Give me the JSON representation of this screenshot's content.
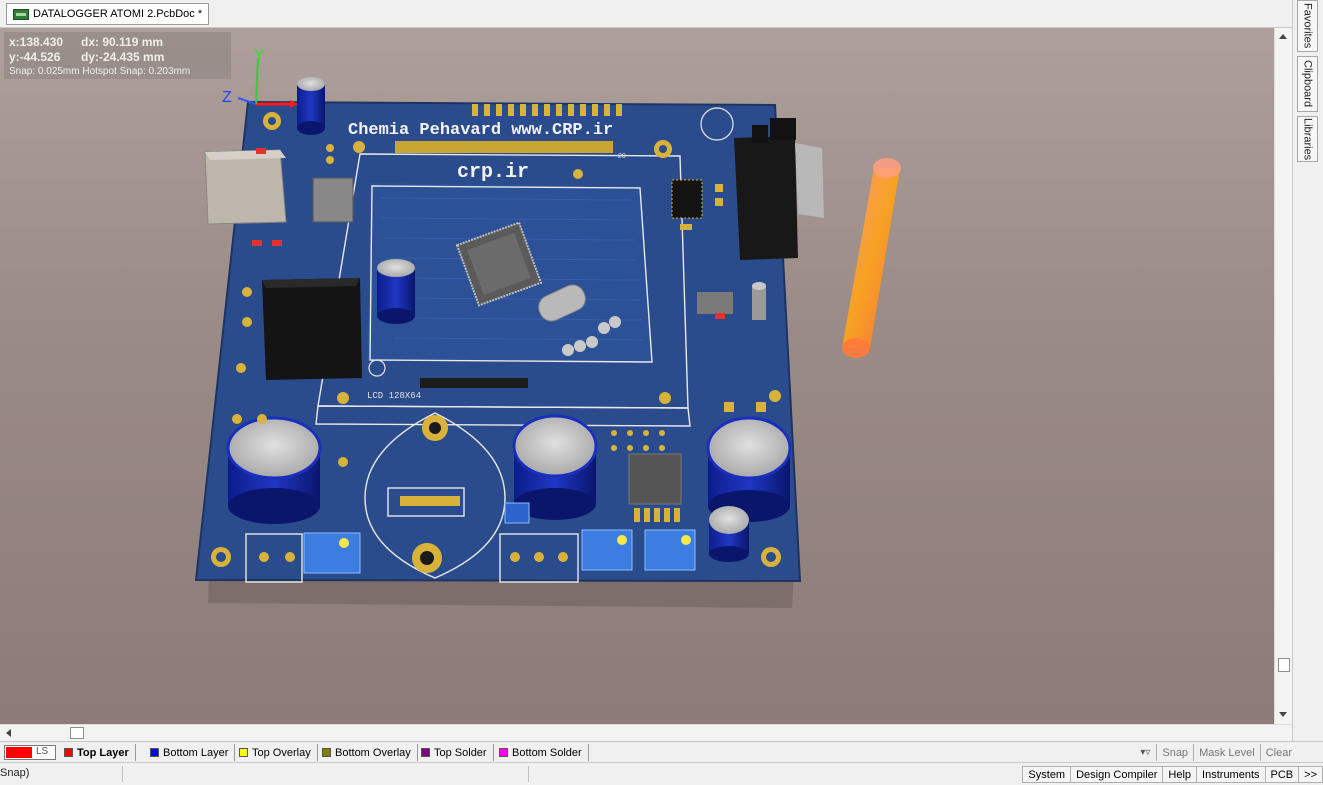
{
  "document_tab": {
    "title": "DATALOGGER ATOMI 2.PcbDoc *"
  },
  "side_panel": {
    "tabs": [
      "Favorites",
      "Clipboard",
      "Libraries"
    ]
  },
  "coords": {
    "x": "x:138.430",
    "dx": "dx: 90.119 mm",
    "y": "y:-44.526",
    "dy": "dy:-24.435  mm",
    "snap": "Snap: 0.025mm Hotspot Snap: 0.203mm"
  },
  "axes": {
    "x": "X",
    "y": "Y",
    "z": "Z"
  },
  "board": {
    "title": "Chemia Pehavard www.CRP.ir",
    "logo": "crp.ir",
    "lcd_label": "LCD 128X64",
    "pin_marker": "20"
  },
  "layer_bar": {
    "ls_label": "LS",
    "layers": [
      {
        "name": "Top Layer",
        "color": "#ff0000",
        "active": true
      },
      {
        "name": "Bottom Layer",
        "color": "#0000ff"
      },
      {
        "name": "Top Overlay",
        "color": "#ffff00"
      },
      {
        "name": "Bottom Overlay",
        "color": "#808000"
      },
      {
        "name": "Top Solder",
        "color": "#800080"
      },
      {
        "name": "Bottom Solder",
        "color": "#ff00ff"
      }
    ],
    "buttons": [
      "Snap",
      "Mask Level",
      "Clear"
    ]
  },
  "status_bar": {
    "message": "Snap)",
    "buttons": [
      "System",
      "Design Compiler",
      "Help",
      "Instruments",
      "PCB"
    ],
    "more": ">>"
  },
  "colors": {
    "board": "#2b4c8c",
    "pad": "#d8b23a",
    "accent": "#ff0000"
  }
}
